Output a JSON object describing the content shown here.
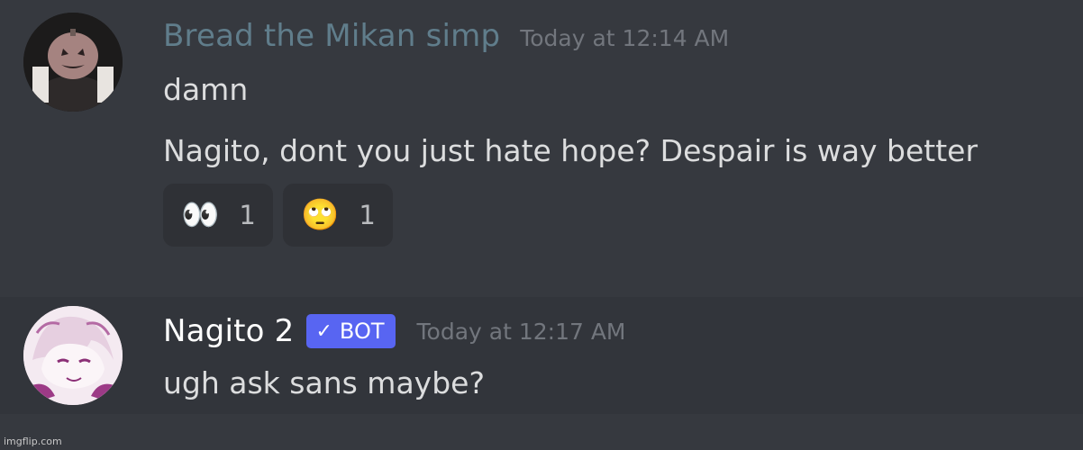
{
  "messages": [
    {
      "username": "Bread the Mikan simp",
      "timestamp": "Today at 12:14 AM",
      "lines": [
        "damn",
        "Nagito, dont you just hate hope? Despair is way better"
      ],
      "reactions": [
        {
          "emoji": "👀",
          "count": "1"
        },
        {
          "emoji": "🙄",
          "count": "1"
        }
      ]
    },
    {
      "username": "Nagito 2",
      "badge": "BOT",
      "badge_check": "✓",
      "timestamp": "Today at 12:17 AM",
      "lines": [
        "ugh ask sans maybe?"
      ]
    }
  ],
  "watermark": "imgflip.com",
  "colors": {
    "background": "#36393f",
    "highlight_background": "#32353b",
    "username1": "#607d8b",
    "bot_badge": "#5865f2",
    "reaction_bg": "#2f3136"
  }
}
